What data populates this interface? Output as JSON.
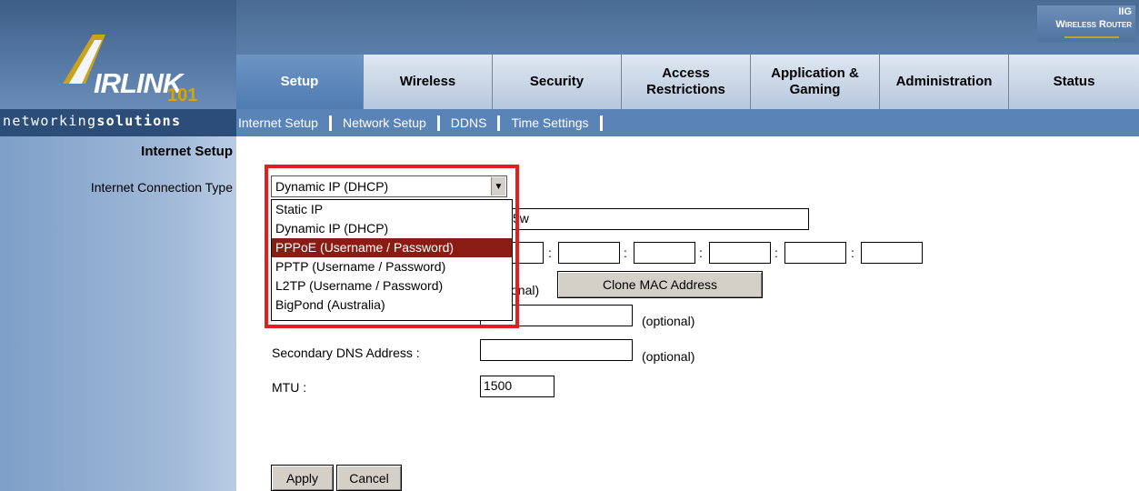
{
  "header": {
    "logo_text": "IRLINK",
    "logo_num": "101",
    "brand_right_line1": "IIG",
    "brand_right_line2": "Wireless Router",
    "tagline_regular": "networking",
    "tagline_bold": "solutions"
  },
  "tabs": [
    {
      "label": "Setup",
      "active": true
    },
    {
      "label": "Wireless"
    },
    {
      "label": "Security"
    },
    {
      "label": "Access Restrictions"
    },
    {
      "label": "Application & Gaming"
    },
    {
      "label": "Administration"
    },
    {
      "label": "Status"
    }
  ],
  "subnav": [
    "Internet Setup",
    "Network Setup",
    "DDNS",
    "Time Settings"
  ],
  "sidebar": {
    "title": "Internet Setup",
    "label": "Internet Connection Type"
  },
  "connection": {
    "selected": "Dynamic IP (DHCP)",
    "options": [
      "Static IP",
      "Dynamic IP (DHCP)",
      "PPPoE (Username / Password)",
      "PPTP (Username / Password)",
      "L2TP (Username / Password)",
      "BigPond (Australia)"
    ],
    "highlighted_index": 2
  },
  "form": {
    "hostname_partial": "5w",
    "mac_optional_partial": "onal)",
    "clone_button": "Clone MAC Address",
    "primary_dns_optional": "(optional)",
    "secondary_dns_label": "Secondary DNS Address :",
    "secondary_dns_optional": "(optional)",
    "mtu_label": "MTU :",
    "mtu_value": "1500"
  },
  "buttons": {
    "apply": "Apply",
    "cancel": "Cancel"
  },
  "colors": {
    "highlight": "#8a1c14",
    "callout": "#e41e1e",
    "tab_active": "#5a84b8"
  }
}
